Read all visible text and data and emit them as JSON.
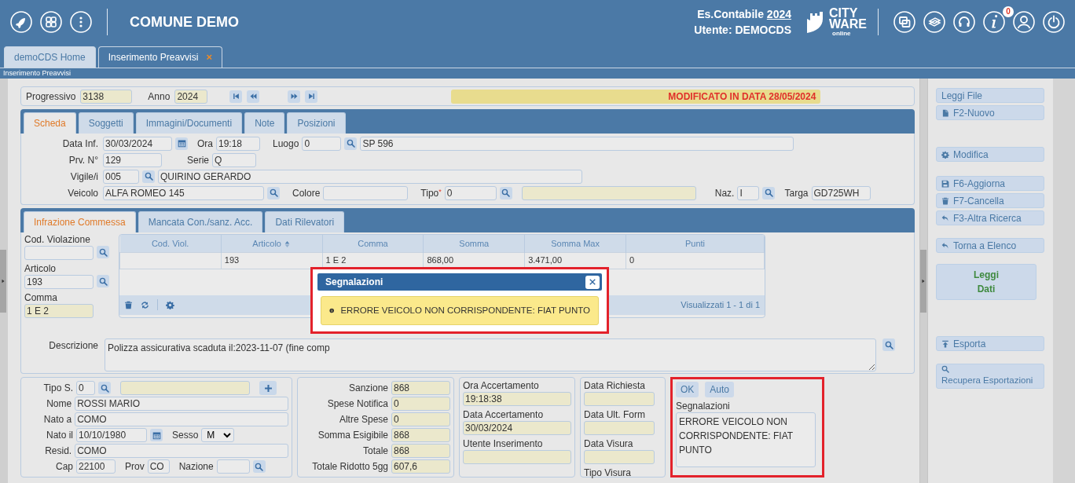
{
  "header": {
    "title": "COMUNE DEMO",
    "fiscal_year_label": "Es.Contabile",
    "fiscal_year": "2024",
    "user": "Utente: DEMOCDS",
    "logo_lines": [
      "CITY",
      "WARE",
      "online"
    ],
    "notifications": "0"
  },
  "tabs": [
    {
      "label": "demoCDS Home",
      "selected": false
    },
    {
      "label": "Inserimento Preavvisi",
      "selected": true,
      "close": "×"
    }
  ],
  "breadcrumb": "Inserimento Preavvisi",
  "record": {
    "progressivo": {
      "label": "Progressivo",
      "value": "3138",
      "readonly": true
    },
    "anno": {
      "label": "Anno",
      "value": "2024",
      "readonly": true
    },
    "status": "MODIFICATO IN DATA 28/05/2024"
  },
  "form_tabs": [
    {
      "label": "Scheda",
      "selected": true
    },
    {
      "label": "Soggetti",
      "selected": false
    },
    {
      "label": "Immagini/Documenti",
      "selected": false
    },
    {
      "label": "Note",
      "selected": false
    },
    {
      "label": "Posizioni",
      "selected": false
    }
  ],
  "scheda": {
    "data_inf": {
      "label": "Data Inf.",
      "value": "30/03/2024",
      "readonly": false
    },
    "ora": {
      "label": "Ora",
      "value": "19:18",
      "readonly": false
    },
    "luogo": {
      "label": "Luogo",
      "value": "0",
      "readonly": false
    },
    "luogo_desc": {
      "value": "SP 596",
      "readonly": false
    },
    "prv_n": {
      "label": "Prv. N°",
      "value": "129",
      "readonly": false
    },
    "serie": {
      "label": "Serie",
      "value": "Q",
      "readonly": false
    },
    "vigile": {
      "label": "Vigile/i",
      "value": "005",
      "readonly": false
    },
    "vigile_nome": {
      "value": "QUIRINO GERARDO",
      "readonly": false
    },
    "veicolo": {
      "label": "Veicolo",
      "value": "ALFA ROMEO 145",
      "readonly": false
    },
    "colore": {
      "label": "Colore",
      "readonly": false
    },
    "tipo": {
      "label": "Tipo$^{*}$",
      "value": "0",
      "readonly": false
    },
    "tipo_desc": {
      "readonly": true
    },
    "naz": {
      "label": "Naz.",
      "value": "I",
      "readonly": false
    },
    "targa": {
      "label": "Targa",
      "value": "GD725WH",
      "readonly": false
    }
  },
  "sub_tabs": [
    {
      "label": "Infrazione Commessa",
      "selected": true
    },
    {
      "label": "Mancata Con./sanz. Acc.",
      "selected": false
    },
    {
      "label": "Dati Rilevatori",
      "selected": false
    }
  ],
  "infrazione": {
    "cod_violazione": {
      "label": "Cod. Violazione",
      "readonly": false
    },
    "articolo": {
      "label": "Articolo",
      "value": "193",
      "readonly": false
    },
    "comma": {
      "label": "Comma",
      "value": "1 E 2",
      "readonly": true
    },
    "grid": {
      "columns": [
        {
          "label": "Cod. Viol.",
          "sorted": false
        },
        {
          "label": "Articolo",
          "sorted": true
        },
        {
          "label": "Comma",
          "sorted": false
        },
        {
          "label": "Somma",
          "sorted": false
        },
        {
          "label": "Somma Max",
          "sorted": false
        },
        {
          "label": "Punti",
          "sorted": false
        }
      ],
      "rows": [
        {
          "cells": [
            null,
            "193",
            "1 E 2",
            "868,00",
            "3.471,00",
            "0"
          ]
        }
      ],
      "footer": "Visualizzati 1 - 1 di 1"
    },
    "descrizione": {
      "label": "Descrizione",
      "value": "Polizza assicurativa scaduta il:2023-11-07 (fine comp"
    }
  },
  "soggetto": {
    "tipo_s": {
      "label": "Tipo S.",
      "value": "0",
      "readonly": false
    },
    "tipo_desc": {
      "readonly": true
    },
    "nome": {
      "label": "Nome",
      "value": "ROSSI MARIO",
      "readonly": false
    },
    "nato_a": {
      "label": "Nato a",
      "value": "COMO",
      "readonly": false
    },
    "nato_il": {
      "label": "Nato il",
      "value": "10/10/1980",
      "readonly": false
    },
    "sesso": {
      "label": "Sesso",
      "value": "M"
    },
    "resid": {
      "label": "Resid.",
      "value": "COMO",
      "readonly": false
    },
    "cap": {
      "label": "Cap",
      "value": "22100",
      "readonly": false
    },
    "prov": {
      "label": "Prov",
      "value": "CO",
      "readonly": false
    },
    "nazione": {
      "label": "Nazione",
      "readonly": false
    }
  },
  "importi": [
    {
      "label": "Sanzione",
      "value": "868",
      "readonly": true
    },
    {
      "label": "Spese Notifica",
      "value": "0",
      "readonly": true
    },
    {
      "label": "Altre Spese",
      "value": "0",
      "readonly": true
    },
    {
      "label": "Somma Esigibile",
      "value": "868",
      "readonly": true
    },
    {
      "label": "Totale",
      "value": "868",
      "readonly": true
    },
    {
      "label": "Totale Ridotto 5gg",
      "value": "607,6",
      "readonly": true
    }
  ],
  "accertamento": [
    {
      "label": "Ora Accertamento",
      "value": "19:18:38",
      "readonly": true
    },
    {
      "label": "Data Accertamento",
      "value": "30/03/2024",
      "readonly": true
    },
    {
      "label": "Utente Inserimento",
      "readonly": true
    }
  ],
  "visura": [
    {
      "kind": "field",
      "label": "Data Richiesta",
      "readonly": true
    },
    {
      "kind": "field",
      "label": "Data Ult. Form",
      "readonly": true
    },
    {
      "kind": "field",
      "label": "Data Visura",
      "readonly": true
    },
    {
      "kind": "label",
      "label": "Tipo Visura"
    }
  ],
  "segnalazioni": {
    "buttons": [
      "OK",
      "Auto"
    ],
    "label": "Segnalazioni",
    "text": "ERRORE VEICOLO NON CORRISPONDENTE: FIAT PUNTO"
  },
  "actions": [
    {
      "label": "Leggi File",
      "kind": "small"
    },
    {
      "label": "F2-Nuovo",
      "kind": "small"
    },
    {
      "label": "Modifica",
      "kind": "small"
    },
    {
      "label": "F6-Aggiorna",
      "kind": "small"
    },
    {
      "label": "F7-Cancella",
      "kind": "small"
    },
    {
      "label": "F3-Altra Ricerca",
      "kind": "small"
    },
    {
      "label": "Torna a Elenco",
      "kind": "small"
    },
    {
      "label": "Leggi Dati",
      "kind": "large"
    },
    {
      "label": "Esporta",
      "kind": "small"
    },
    {
      "label": "Recupera Esportazioni",
      "kind": "tall"
    }
  ],
  "dialog": {
    "title": "Segnalazioni",
    "message": "ERRORE VEICOLO NON CORRISPONDENTE: FIAT PUNTO"
  }
}
